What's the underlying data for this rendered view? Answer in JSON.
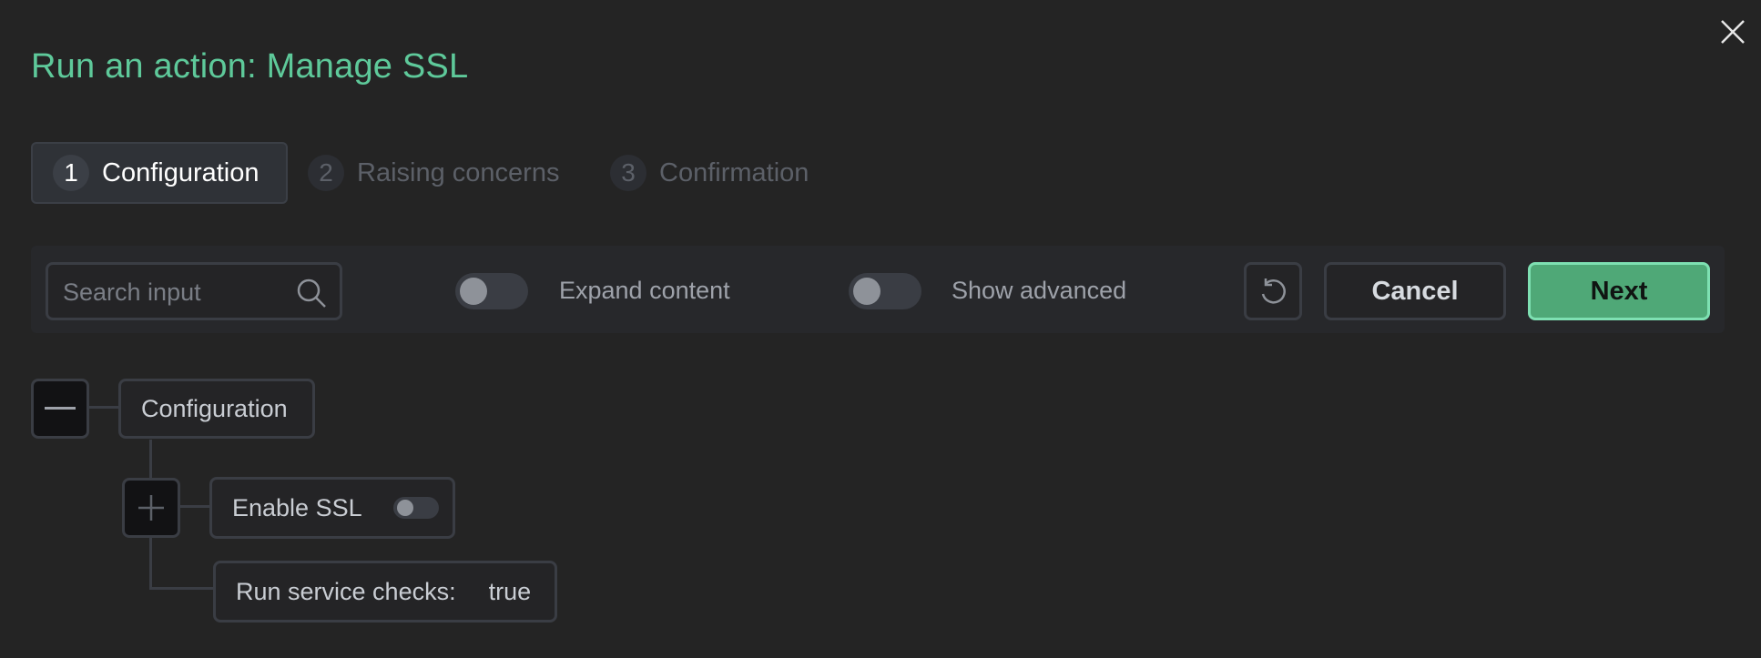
{
  "dialog": {
    "title": "Run an action: Manage SSL",
    "close_icon": "close-icon"
  },
  "steps": [
    {
      "number": "1",
      "label": "Configuration",
      "state": "active"
    },
    {
      "number": "2",
      "label": "Raising concerns",
      "state": "inactive"
    },
    {
      "number": "3",
      "label": "Confirmation",
      "state": "inactive"
    }
  ],
  "toolbar": {
    "search": {
      "placeholder": "Search input",
      "value": "",
      "icon": "search-icon"
    },
    "expand_content": {
      "label": "Expand content",
      "on": false
    },
    "show_advanced": {
      "label": "Show advanced",
      "on": false
    },
    "reset_icon": "reset-icon",
    "cancel_label": "Cancel",
    "next_label": "Next"
  },
  "tree": {
    "root": {
      "label": "Configuration",
      "collapse_icon": "minus-icon"
    },
    "children": [
      {
        "label": "Enable SSL",
        "expand_icon": "plus-icon",
        "toggle_on": false
      },
      {
        "label": "Run service checks:",
        "value": "true"
      }
    ]
  },
  "colors": {
    "accent": "#5ec99a",
    "primary_button": "#4fa877",
    "background": "#242424"
  }
}
